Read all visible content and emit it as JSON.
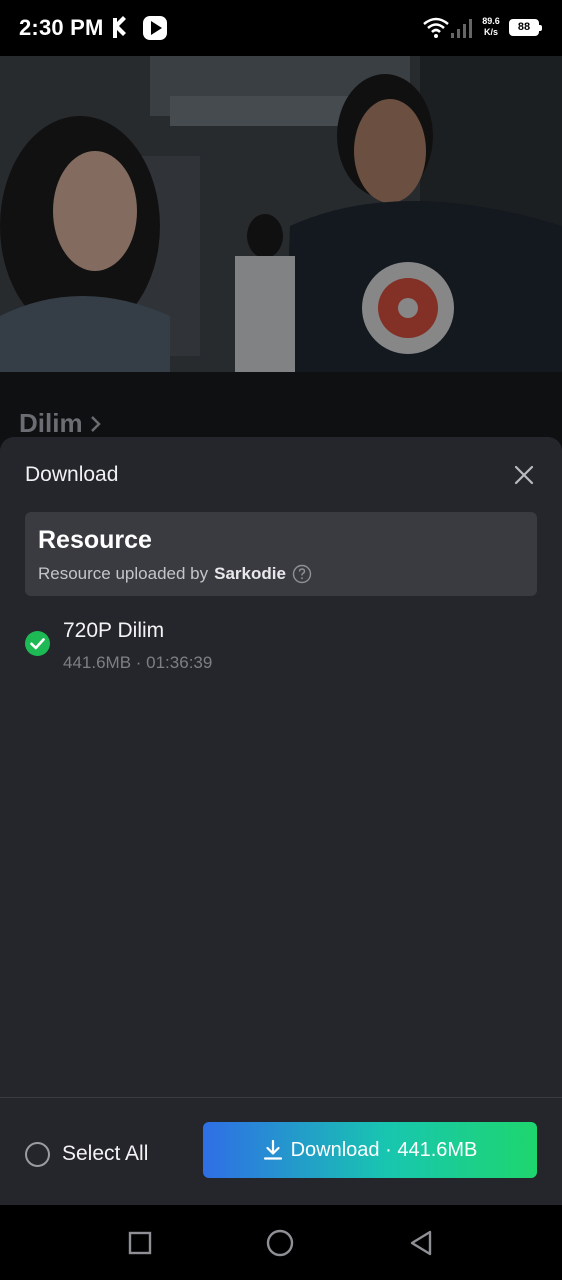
{
  "status_bar": {
    "time": "2:30 PM",
    "net_speed_value": "89.6",
    "net_speed_unit": "K/s",
    "battery": "88"
  },
  "movie": {
    "title": "Dilim"
  },
  "sheet": {
    "title": "Download",
    "resource": {
      "heading": "Resource",
      "uploaded_by_text": "Resource uploaded by",
      "uploader": "Sarkodie"
    },
    "files": [
      {
        "name": "720P Dilim",
        "meta": "441.6MB · 01:36:39",
        "checked": true
      }
    ],
    "select_all_label": "Select All",
    "download_button_label": "Download · 441.6MB"
  },
  "icons": {
    "close": "close-icon",
    "help": "help-circle-icon",
    "check": "check-circle-icon",
    "download": "download-icon",
    "chevron": "chevron-right-icon"
  },
  "colors": {
    "sheet_bg": "#25262b",
    "card_bg": "#3a3b40",
    "check_green": "#1db954",
    "button_gradient_start": "#2f6ee6",
    "button_gradient_end": "#1ed66e"
  }
}
